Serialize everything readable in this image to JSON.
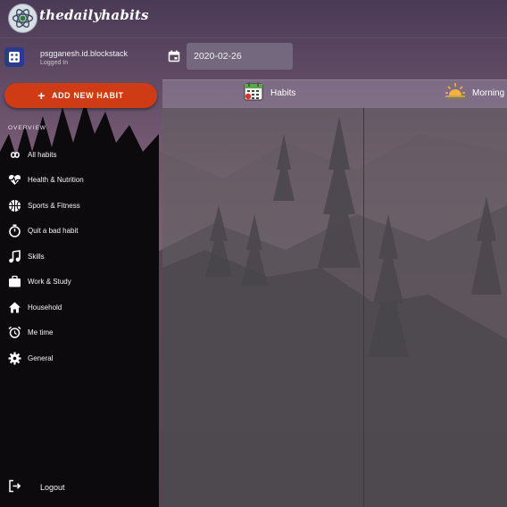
{
  "app": {
    "brand": "thedailyhabits"
  },
  "user": {
    "name": "psgganesh.id.blockstack",
    "status": "Logged In"
  },
  "date": {
    "value": "2020-02-26"
  },
  "actions": {
    "add_label": "ADD NEW HABIT"
  },
  "sidebar": {
    "section_title": "OVERVIEW",
    "items": [
      {
        "label": "All habits",
        "icon": "infinity-icon"
      },
      {
        "label": "Health & Nutrition",
        "icon": "heart-pulse-icon"
      },
      {
        "label": "Sports & Fitness",
        "icon": "basketball-icon"
      },
      {
        "label": "Quit a bad habit",
        "icon": "stopwatch-icon"
      },
      {
        "label": "Skills",
        "icon": "music-note-icon"
      },
      {
        "label": "Work & Study",
        "icon": "briefcase-icon"
      },
      {
        "label": "Household",
        "icon": "home-icon"
      },
      {
        "label": "Me time",
        "icon": "alarm-clock-icon"
      },
      {
        "label": "General",
        "icon": "gear-icon"
      }
    ],
    "logout_label": "Logout"
  },
  "board": {
    "columns": [
      {
        "label": "Habits",
        "icon": "calendar-grid-icon"
      },
      {
        "label": "Morning",
        "icon": "sunrise-icon"
      }
    ]
  },
  "colors": {
    "accent": "#cf3b14",
    "avatar_bg": "#2a3a8c",
    "sidebar_bg": "#000000",
    "board_bg": "#616161"
  }
}
